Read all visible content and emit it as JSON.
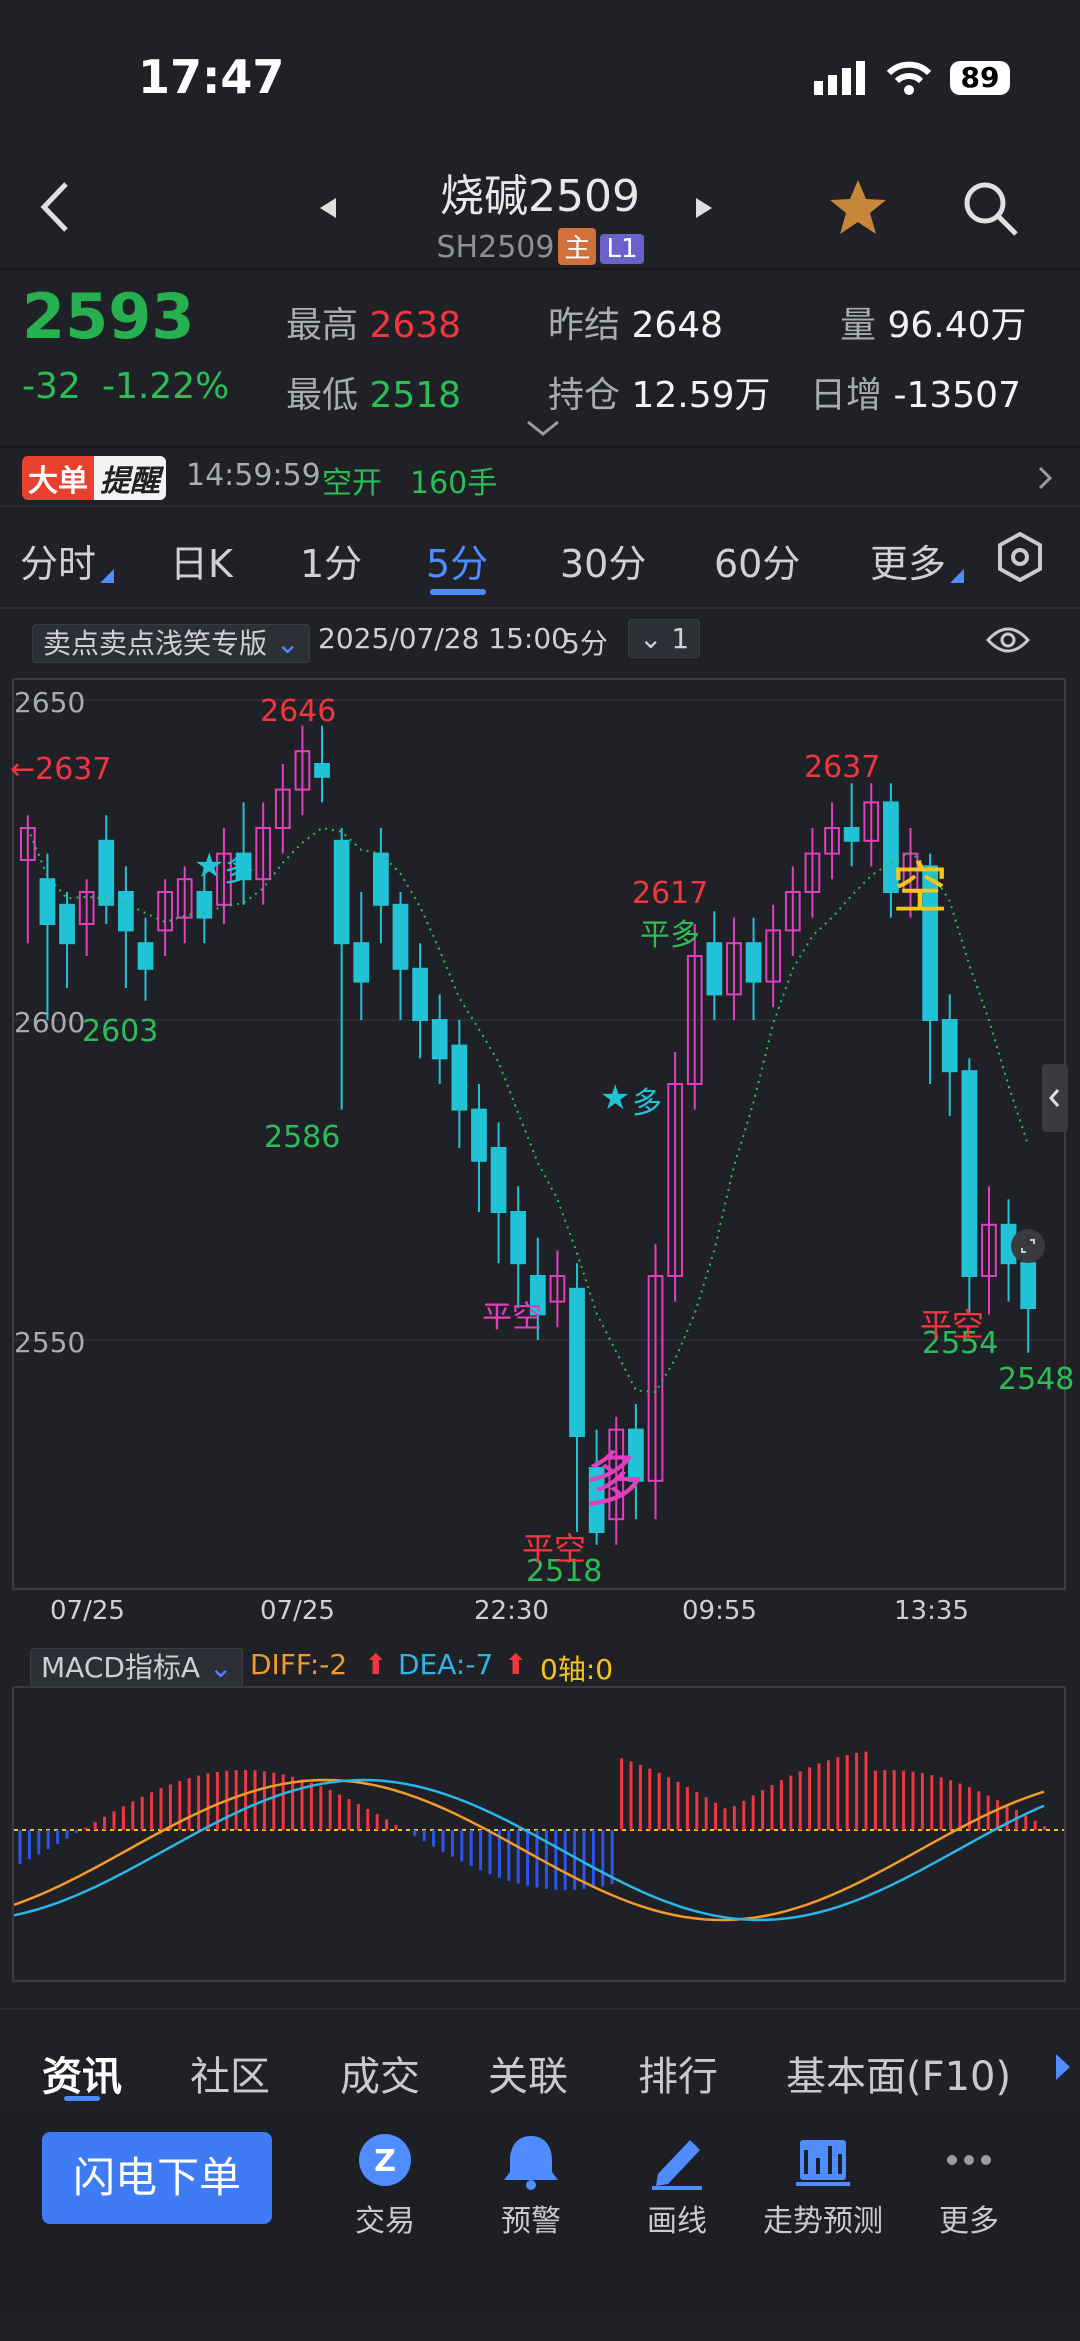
{
  "status": {
    "time": "17:47",
    "battery": "89"
  },
  "header": {
    "title": "烧碱2509",
    "code": "SH2509",
    "tag_main": "主",
    "tag_l1": "L1"
  },
  "quote": {
    "last": "2593",
    "change": "-32",
    "change_pct": "-1.22%",
    "high_label": "最高",
    "high": "2638",
    "low_label": "最低",
    "low": "2518",
    "prev_settle_label": "昨结",
    "prev_settle": "2648",
    "open_interest_label": "持仓",
    "open_interest": "12.59万",
    "volume_label": "量",
    "volume": "96.40万",
    "daily_inc_label": "日增",
    "daily_inc": "-13507"
  },
  "alert": {
    "badge1": "大单",
    "badge2": "提醒",
    "time": "14:59:59",
    "type": "空开",
    "qty": "160手"
  },
  "period_tabs": [
    "分时",
    "日K",
    "1分",
    "5分",
    "30分",
    "60分",
    "更多"
  ],
  "indicator": {
    "name": "卖点卖点浅笑专版",
    "datetime": "2025/07/28 15:00",
    "period": "5分",
    "multiplier": "1"
  },
  "chart": {
    "y_ticks": [
      "2650",
      "2600",
      "2550"
    ],
    "x_ticks": [
      "07/25",
      "07/25",
      "22:30",
      "09:55",
      "13:35"
    ],
    "labels": {
      "left_price": "←2637",
      "h1": "2646",
      "l1": "2603",
      "l2": "2586",
      "h2": "2617",
      "h3": "2637",
      "l3": "2518",
      "l4": "2554",
      "l5": "2548"
    },
    "signals": {
      "duo": "多",
      "kong": "空",
      "ping_kong": "平空",
      "ping_duo": "平多",
      "star": "★"
    }
  },
  "macd": {
    "name": "MACD指标A",
    "diff": "DIFF:-2",
    "dea": "DEA:-7",
    "zero": "0轴:0"
  },
  "bottom_tabs": [
    "资讯",
    "社区",
    "成交",
    "关联",
    "排行",
    "基本面(F10)"
  ],
  "toolbar": {
    "order": "闪电下单",
    "items": [
      "交易",
      "预警",
      "画线",
      "走势预测",
      "更多"
    ]
  },
  "chart_data": {
    "type": "candlestick",
    "y_range": [
      2500,
      2660
    ],
    "candles": [
      {
        "o": 2625,
        "c": 2630,
        "h": 2632,
        "l": 2612
      },
      {
        "o": 2622,
        "c": 2615,
        "h": 2626,
        "l": 2600
      },
      {
        "o": 2618,
        "c": 2612,
        "h": 2620,
        "l": 2605
      },
      {
        "o": 2615,
        "c": 2620,
        "h": 2622,
        "l": 2610
      },
      {
        "o": 2628,
        "c": 2618,
        "h": 2632,
        "l": 2615
      },
      {
        "o": 2620,
        "c": 2614,
        "h": 2624,
        "l": 2605
      },
      {
        "o": 2612,
        "c": 2608,
        "h": 2616,
        "l": 2603
      },
      {
        "o": 2614,
        "c": 2620,
        "h": 2622,
        "l": 2610
      },
      {
        "o": 2616,
        "c": 2622,
        "h": 2624,
        "l": 2612
      },
      {
        "o": 2620,
        "c": 2616,
        "h": 2624,
        "l": 2612
      },
      {
        "o": 2618,
        "c": 2626,
        "h": 2630,
        "l": 2615
      },
      {
        "o": 2626,
        "c": 2622,
        "h": 2634,
        "l": 2618
      },
      {
        "o": 2622,
        "c": 2630,
        "h": 2634,
        "l": 2618
      },
      {
        "o": 2630,
        "c": 2636,
        "h": 2640,
        "l": 2626
      },
      {
        "o": 2636,
        "c": 2642,
        "h": 2646,
        "l": 2632
      },
      {
        "o": 2640,
        "c": 2638,
        "h": 2646,
        "l": 2634
      },
      {
        "o": 2628,
        "c": 2612,
        "h": 2630,
        "l": 2586
      },
      {
        "o": 2612,
        "c": 2606,
        "h": 2620,
        "l": 2600
      },
      {
        "o": 2626,
        "c": 2618,
        "h": 2630,
        "l": 2612
      },
      {
        "o": 2618,
        "c": 2608,
        "h": 2620,
        "l": 2600
      },
      {
        "o": 2608,
        "c": 2600,
        "h": 2612,
        "l": 2594
      },
      {
        "o": 2600,
        "c": 2594,
        "h": 2604,
        "l": 2590
      },
      {
        "o": 2596,
        "c": 2586,
        "h": 2600,
        "l": 2580
      },
      {
        "o": 2586,
        "c": 2578,
        "h": 2590,
        "l": 2570
      },
      {
        "o": 2580,
        "c": 2570,
        "h": 2584,
        "l": 2562
      },
      {
        "o": 2570,
        "c": 2562,
        "h": 2574,
        "l": 2555
      },
      {
        "o": 2560,
        "c": 2554,
        "h": 2566,
        "l": 2550
      },
      {
        "o": 2556,
        "c": 2560,
        "h": 2564,
        "l": 2552
      },
      {
        "o": 2558,
        "c": 2535,
        "h": 2562,
        "l": 2520
      },
      {
        "o": 2530,
        "c": 2520,
        "h": 2536,
        "l": 2518
      },
      {
        "o": 2522,
        "c": 2536,
        "h": 2538,
        "l": 2518
      },
      {
        "o": 2536,
        "c": 2528,
        "h": 2540,
        "l": 2522
      },
      {
        "o": 2528,
        "c": 2560,
        "h": 2565,
        "l": 2522
      },
      {
        "o": 2560,
        "c": 2590,
        "h": 2595,
        "l": 2556
      },
      {
        "o": 2590,
        "c": 2610,
        "h": 2615,
        "l": 2586
      },
      {
        "o": 2612,
        "c": 2604,
        "h": 2617,
        "l": 2600
      },
      {
        "o": 2604,
        "c": 2612,
        "h": 2616,
        "l": 2600
      },
      {
        "o": 2612,
        "c": 2606,
        "h": 2616,
        "l": 2600
      },
      {
        "o": 2606,
        "c": 2614,
        "h": 2618,
        "l": 2602
      },
      {
        "o": 2614,
        "c": 2620,
        "h": 2624,
        "l": 2610
      },
      {
        "o": 2620,
        "c": 2626,
        "h": 2630,
        "l": 2616
      },
      {
        "o": 2626,
        "c": 2630,
        "h": 2634,
        "l": 2622
      },
      {
        "o": 2630,
        "c": 2628,
        "h": 2637,
        "l": 2624
      },
      {
        "o": 2628,
        "c": 2634,
        "h": 2637,
        "l": 2624
      },
      {
        "o": 2634,
        "c": 2620,
        "h": 2637,
        "l": 2616
      },
      {
        "o": 2620,
        "c": 2626,
        "h": 2630,
        "l": 2616
      },
      {
        "o": 2624,
        "c": 2600,
        "h": 2626,
        "l": 2590
      },
      {
        "o": 2600,
        "c": 2592,
        "h": 2604,
        "l": 2585
      },
      {
        "o": 2592,
        "c": 2560,
        "h": 2594,
        "l": 2554
      },
      {
        "o": 2560,
        "c": 2568,
        "h": 2574,
        "l": 2554
      },
      {
        "o": 2568,
        "c": 2562,
        "h": 2572,
        "l": 2556
      },
      {
        "o": 2562,
        "c": 2555,
        "h": 2566,
        "l": 2548
      }
    ],
    "macd": {
      "diff_label": "DIFF",
      "dea_label": "DEA"
    }
  }
}
